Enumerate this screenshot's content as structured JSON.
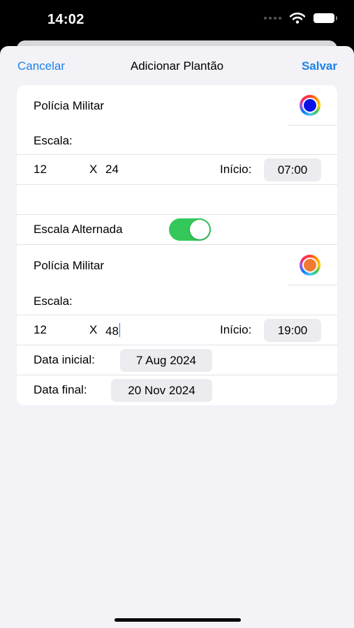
{
  "status_bar": {
    "time": "14:02"
  },
  "nav": {
    "cancel_label": "Cancelar",
    "title": "Adicionar Plantão",
    "save_label": "Salvar"
  },
  "shift1": {
    "name": "Polícia Militar",
    "color": "#0a12e8",
    "escala_label": "Escala:",
    "hours_on": "12",
    "x_label": "X",
    "hours_off": "24",
    "inicio_label": "Início:",
    "start_time": "07:00"
  },
  "alternate": {
    "label": "Escala Alternada",
    "enabled": true
  },
  "shift2": {
    "name": "Polícia Militar",
    "color": "#f07a30",
    "escala_label": "Escala:",
    "hours_on": "12",
    "x_label": "X",
    "hours_off": "48",
    "inicio_label": "Início:",
    "start_time": "19:00"
  },
  "dates": {
    "start_label": "Data inicial:",
    "start_value": "7 Aug 2024",
    "end_label": "Data final:",
    "end_value": "20 Nov 2024"
  },
  "colors": {
    "accent": "#1a82e8",
    "toggle_on": "#34c759",
    "background": "#f2f2f7"
  }
}
